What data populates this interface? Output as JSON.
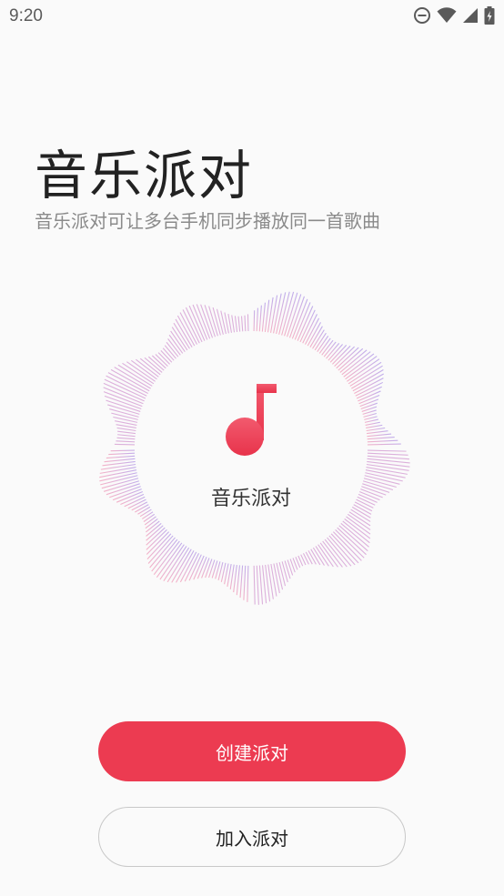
{
  "status_bar": {
    "time": "9:20",
    "icons": [
      "do-not-disturb-icon",
      "wifi-icon",
      "cell-signal-icon",
      "battery-charging-icon"
    ]
  },
  "header": {
    "title": "音乐派对",
    "subtitle": "音乐派对可让多台手机同步播放同一首歌曲"
  },
  "disc": {
    "icon": "music-note-icon",
    "label": "音乐派对"
  },
  "actions": {
    "create_label": "创建派对",
    "join_label": "加入派对"
  },
  "colors": {
    "accent": "#ec3b51",
    "background": "#fafafa",
    "wave_pink": "#f0a6bf",
    "wave_purple": "#b9a0e6"
  }
}
